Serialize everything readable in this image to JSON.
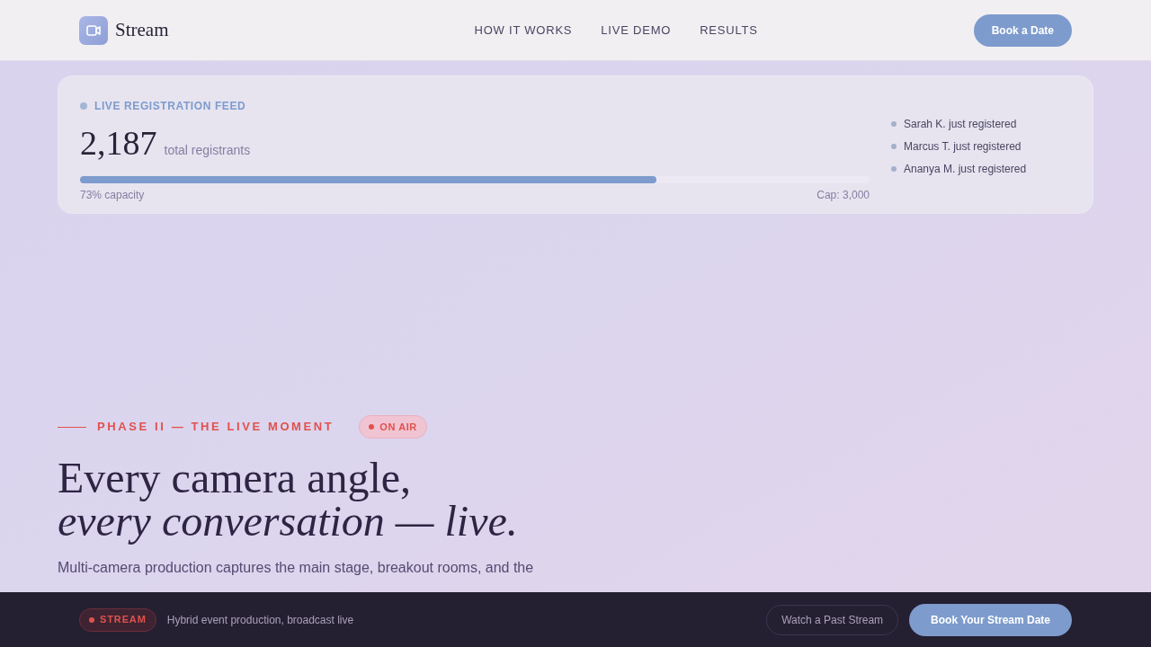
{
  "nav": {
    "brand": "Stream",
    "links": [
      "HOW IT WORKS",
      "LIVE DEMO",
      "RESULTS"
    ],
    "cta": "Book a Date"
  },
  "registration_feed": {
    "label": "LIVE REGISTRATION FEED",
    "count": "2,187",
    "count_label": "total registrants",
    "level": 0.73,
    "capacity": "73% capacity",
    "cap": "Cap: 3,000",
    "recent": [
      "Sarah K. just registered",
      "Marcus T. just registered",
      "Ananya M. just registered"
    ]
  },
  "hero": {
    "eyebrow": "PHASE II — THE LIVE MOMENT",
    "badge": "ON AIR",
    "headline": "Every camera angle,",
    "headline_italic": "every conversation — live.",
    "body": "Multi-camera production captures the main stage, breakout rooms, and the"
  },
  "bottom_bar": {
    "badge": "STREAM",
    "tagline": "Hybrid event production, broadcast live",
    "secondary": "Watch a Past Stream",
    "primary": "Book Your Stream Date"
  }
}
